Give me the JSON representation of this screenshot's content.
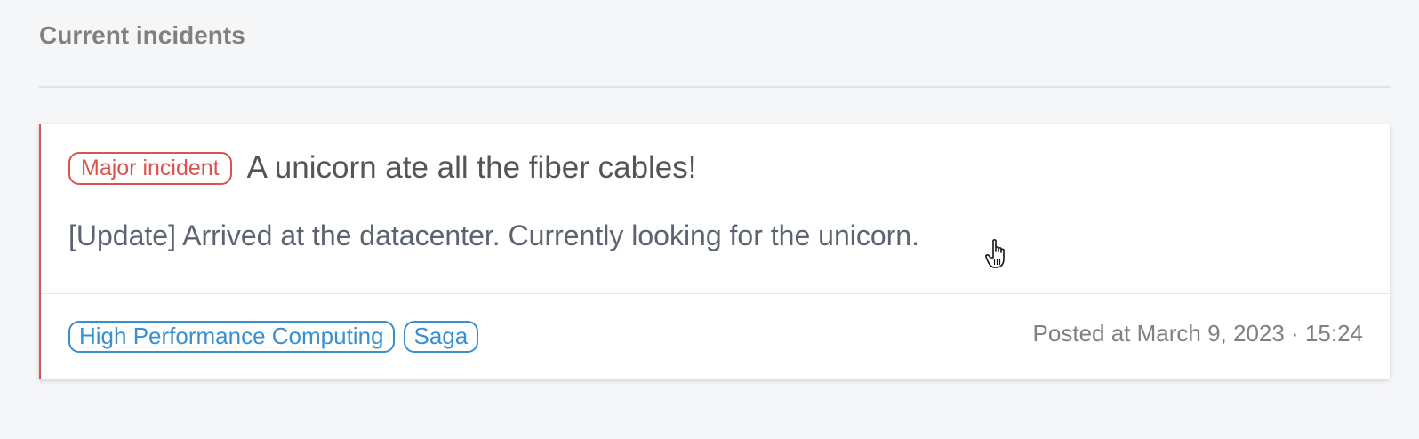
{
  "section": {
    "title": "Current incidents"
  },
  "incident": {
    "severity_label": "Major incident",
    "title": "A unicorn ate all the fiber cables!",
    "update": "[Update] Arrived at the datacenter. Currently looking for the unicorn.",
    "tags": [
      "High Performance Computing",
      "Saga"
    ],
    "posted_at": "Posted at March 9, 2023 · 15:24"
  },
  "icons": {
    "cursor": "pointer-hand-icon"
  },
  "colors": {
    "severity": "#d9534f",
    "tag": "#3a8fd0",
    "background": "#f5f6f8",
    "card": "#ffffff"
  }
}
